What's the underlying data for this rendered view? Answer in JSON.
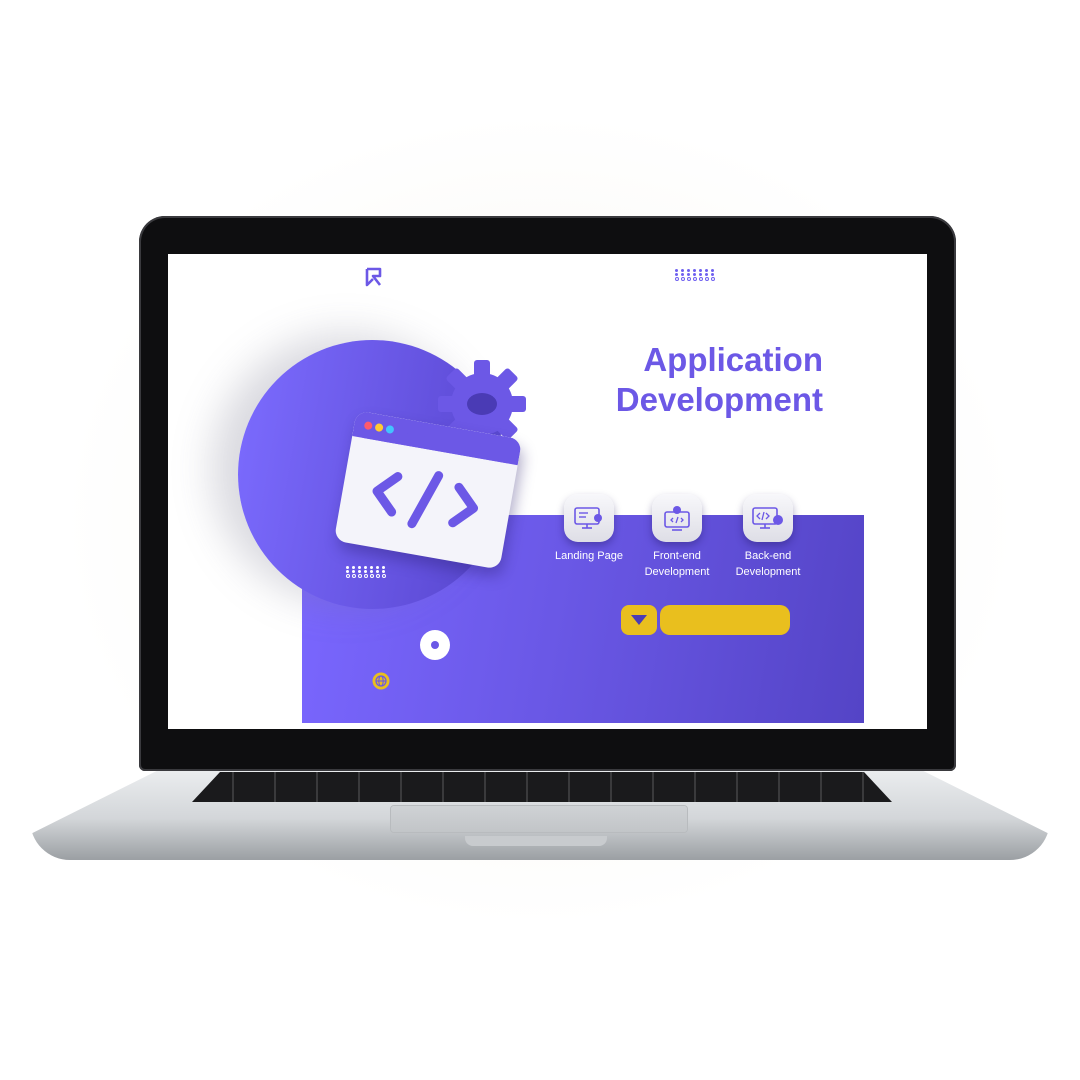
{
  "hero": {
    "title_line1": "Application",
    "title_line2": "Development"
  },
  "services": [
    {
      "label": "Landing Page",
      "icon": "landing-page-icon"
    },
    {
      "label": "Front-end\nDevelopment",
      "icon": "frontend-icon"
    },
    {
      "label": "Back-end\nDevelopment",
      "icon": "backend-icon"
    }
  ],
  "icons": {
    "logo": "brand-logo-icon",
    "code": "code-window-icon",
    "gear": "gear-icon",
    "globe": "globe-icon",
    "dropdown": "caret-down-icon"
  },
  "colors": {
    "accent": "#6c58e6",
    "panel": "#6a58e6",
    "button": "#e9bf1e",
    "text_on_panel": "#ffffff"
  }
}
